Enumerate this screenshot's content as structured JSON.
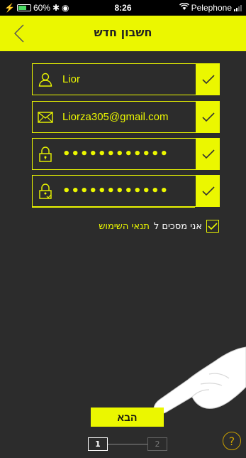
{
  "status_bar": {
    "battery": "60%",
    "time": "8:26",
    "carrier": "Pelephone"
  },
  "header": {
    "title": "חשבון חדש",
    "back_icon": "chevron-left-icon"
  },
  "form": {
    "name": {
      "value": "Lior",
      "icon": "user-icon"
    },
    "email": {
      "value": "Liorza305@gmail.com",
      "icon": "envelope-icon"
    },
    "password": {
      "value": "••••••••••••",
      "icon": "lock-icon"
    },
    "confirm_password": {
      "value": "••••••••••••",
      "icon": "lock-check-icon"
    }
  },
  "terms": {
    "text": "אני מסכים ל",
    "link": "תנאי השימוש",
    "checked": true
  },
  "next_button": "הבא",
  "steps": {
    "current": "1",
    "next": "2"
  },
  "help_label": "?",
  "colors": {
    "accent": "#ebf700",
    "background": "#2c2c2c"
  }
}
